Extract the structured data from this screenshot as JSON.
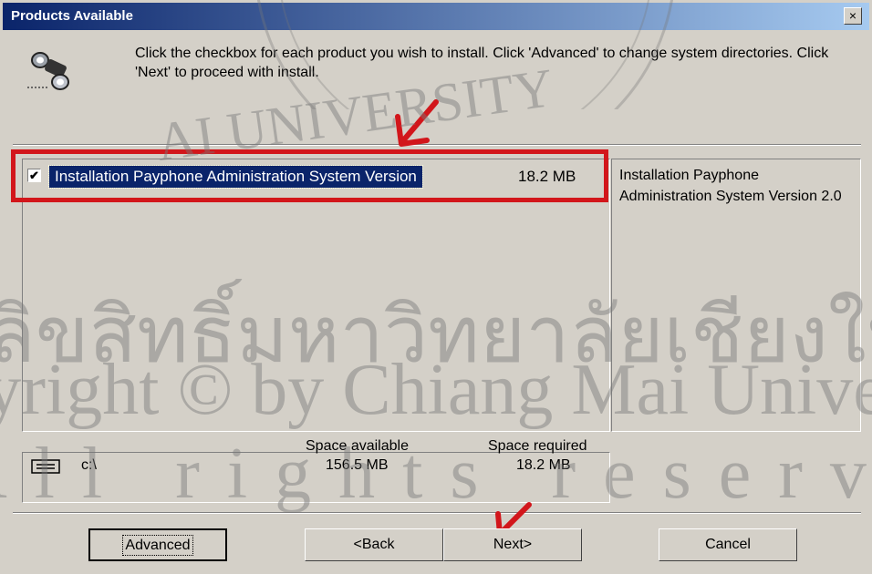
{
  "window": {
    "title": "Products Available",
    "close_label": "×"
  },
  "instruction": "Click the checkbox for each product you wish to install.  Click 'Advanced' to change system directories.  Click 'Next' to proceed with install.",
  "product_list": {
    "items": [
      {
        "label": "Installation Payphone Administration System Version",
        "size": "18.2 MB",
        "checked": true
      }
    ]
  },
  "description": "Installation Payphone Administration System Version 2.0",
  "space": {
    "drive": "c:\\",
    "available_header": "Space available",
    "required_header": "Space required",
    "available_value": "156.5 MB",
    "required_value": "18.2 MB"
  },
  "buttons": {
    "advanced": "Advanced",
    "back": "<Back",
    "next": "Next>",
    "cancel": "Cancel"
  },
  "watermark": {
    "thai": "ลิขสิทธิ์มหาวิทยาลัยเชียงใหม่",
    "line1": "Copyright © by Chiang Mai University",
    "line2": "All rights reserved",
    "seal": "AI UNIVERSITY"
  },
  "annotation_color": "#d2161b"
}
